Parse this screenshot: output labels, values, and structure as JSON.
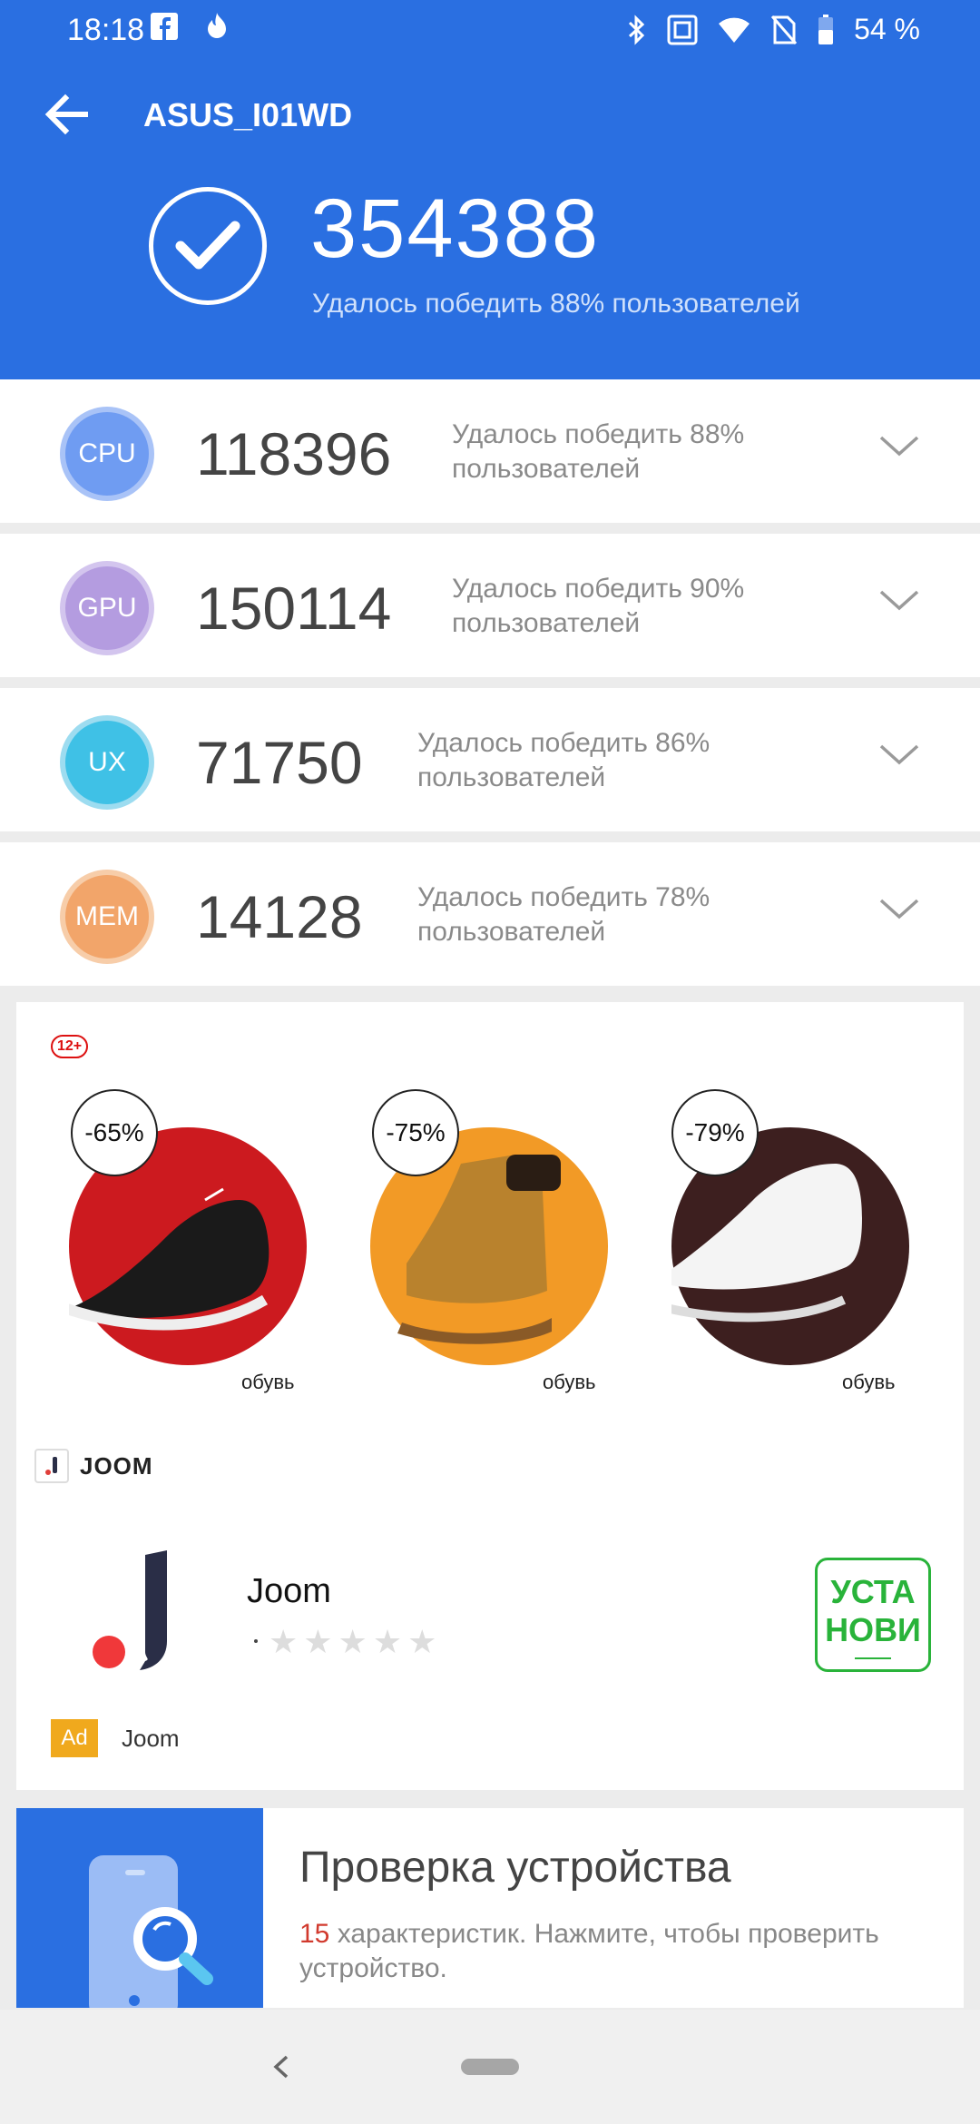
{
  "status_bar": {
    "time": "18:18",
    "battery": "54 %"
  },
  "header": {
    "device_name": "ASUS_I01WD",
    "total_score": "354388",
    "total_subtitle": "Удалось победить 88% пользователей"
  },
  "scores": [
    {
      "label": "CPU",
      "score": "118396",
      "line1": "Удалось победить 88%",
      "line2": "пользователей",
      "color": "#6f9cf2",
      "ring": "#a9c3f7"
    },
    {
      "label": "GPU",
      "score": "150114",
      "line1": "Удалось победить 90%",
      "line2": "пользователей",
      "color": "#b49ce0",
      "ring": "#d3c5ee"
    },
    {
      "label": "UX",
      "score": "71750",
      "line1": "Удалось победить 86%",
      "line2": "пользователей",
      "color": "#3fc1e6",
      "ring": "#9ddcf0"
    },
    {
      "label": "MEM",
      "score": "14128",
      "line1": "Удалось победить 78%",
      "line2": "пользователей",
      "color": "#f2a56a",
      "ring": "#f7cda9"
    }
  ],
  "ad": {
    "age_rating": "12+",
    "products": [
      {
        "discount": "-65%",
        "label": "обувь",
        "bg": "#cc1a1f"
      },
      {
        "discount": "-75%",
        "label": "обувь",
        "bg": "#f29a26"
      },
      {
        "discount": "-79%",
        "label": "обувь",
        "bg": "#3d1f1f"
      }
    ],
    "brand": "JOOM",
    "app_name": "Joom",
    "install_line1": "УСТА",
    "install_line2": "НОВИ",
    "ad_tag": "Ad",
    "advertiser": "Joom"
  },
  "device_check": {
    "title": "Проверка устройства",
    "count": "15",
    "description": " характеристик. Нажмите, чтобы проверить устройство."
  }
}
